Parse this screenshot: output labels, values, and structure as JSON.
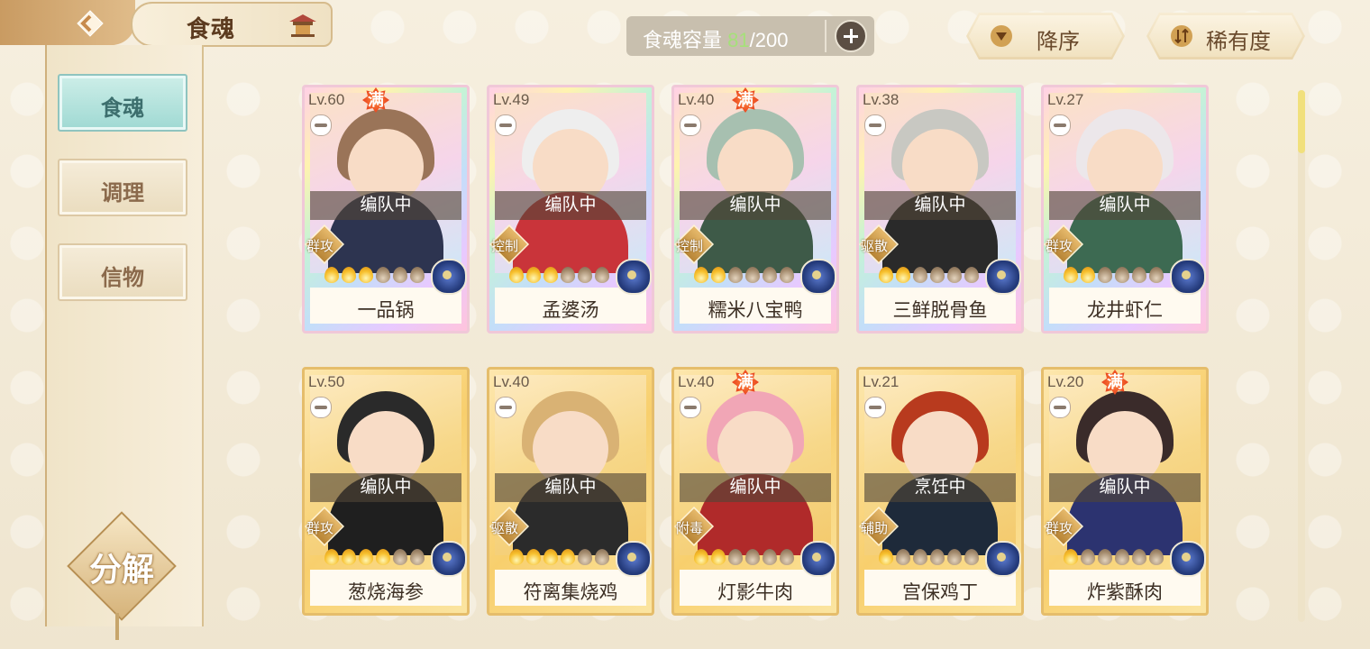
{
  "header": {
    "title": "食魂",
    "capacity_label": "食魂容量",
    "capacity_current": "81",
    "capacity_max": "/200",
    "sort_order_label": "降序",
    "sort_by_label": "稀有度"
  },
  "sidebar": {
    "tabs": [
      {
        "label": "食魂",
        "active": true
      },
      {
        "label": "调理",
        "active": false
      },
      {
        "label": "信物",
        "active": false
      }
    ],
    "decompose_label": "分解"
  },
  "cards": [
    {
      "level": "Lv.60",
      "full": "满",
      "status": "编队中",
      "role": "群攻",
      "stars_on": 3,
      "stars_total": 6,
      "name": "一品锅",
      "frame": "rainbow",
      "hair": "#9a7458",
      "cloth": "#2d3450"
    },
    {
      "level": "Lv.49",
      "full": "",
      "status": "编队中",
      "role": "控制",
      "stars_on": 3,
      "stars_total": 6,
      "name": "孟婆汤",
      "frame": "rainbow",
      "hair": "#eeeeee",
      "cloth": "#c9343a"
    },
    {
      "level": "Lv.40",
      "full": "满",
      "status": "编队中",
      "role": "控制",
      "stars_on": 2,
      "stars_total": 6,
      "name": "糯米八宝鸭",
      "frame": "rainbow",
      "hair": "#a7c0b0",
      "cloth": "#3e5a48"
    },
    {
      "level": "Lv.38",
      "full": "",
      "status": "编队中",
      "role": "驱散",
      "stars_on": 2,
      "stars_total": 6,
      "name": "三鲜脱骨鱼",
      "frame": "rainbow",
      "hair": "#c8c8c2",
      "cloth": "#2a2a2a"
    },
    {
      "level": "Lv.27",
      "full": "",
      "status": "编队中",
      "role": "群攻",
      "stars_on": 2,
      "stars_total": 6,
      "name": "龙井虾仁",
      "frame": "rainbow",
      "hair": "#ece7ea",
      "cloth": "#3d6a52"
    },
    {
      "level": "Lv.50",
      "full": "",
      "status": "编队中",
      "role": "群攻",
      "stars_on": 4,
      "stars_total": 6,
      "name": "葱烧海参",
      "frame": "gold",
      "hair": "#2a2a2a",
      "cloth": "#1f1f1f"
    },
    {
      "level": "Lv.40",
      "full": "",
      "status": "编队中",
      "role": "驱散",
      "stars_on": 4,
      "stars_total": 6,
      "name": "符离集烧鸡",
      "frame": "gold",
      "hair": "#d9b274",
      "cloth": "#2b2b2b"
    },
    {
      "level": "Lv.40",
      "full": "满",
      "status": "编队中",
      "role": "附毒",
      "stars_on": 2,
      "stars_total": 6,
      "name": "灯影牛肉",
      "frame": "gold",
      "hair": "#f1a6b6",
      "cloth": "#b02a2a"
    },
    {
      "level": "Lv.21",
      "full": "",
      "status": "烹饪中",
      "role": "辅助",
      "stars_on": 1,
      "stars_total": 6,
      "name": "宫保鸡丁",
      "frame": "gold",
      "hair": "#b83a1e",
      "cloth": "#1e2a3a"
    },
    {
      "level": "Lv.20",
      "full": "满",
      "status": "编队中",
      "role": "群攻",
      "stars_on": 1,
      "stars_total": 6,
      "name": "炸紫酥肉",
      "frame": "gold",
      "hair": "#3a2b2a",
      "cloth": "#2c3370"
    }
  ]
}
